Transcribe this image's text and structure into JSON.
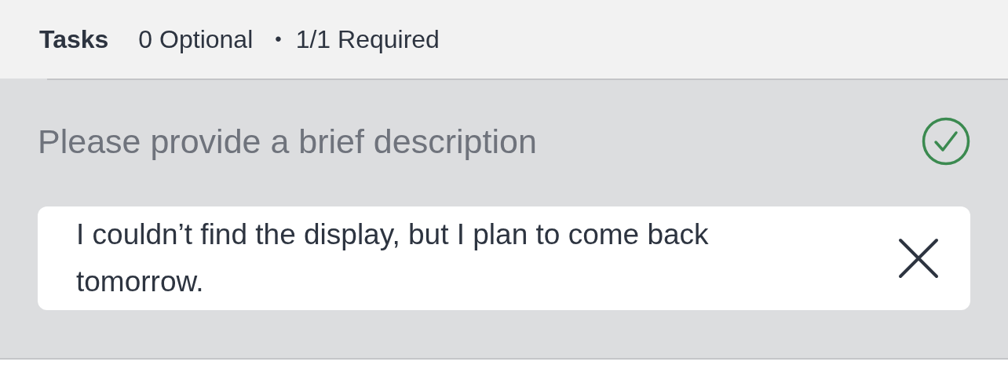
{
  "header": {
    "title": "Tasks",
    "optional": "0 Optional",
    "separator": "•",
    "required": "1/1 Required"
  },
  "task": {
    "prompt": "Please provide a brief description",
    "completed": true,
    "answer": "I couldn’t find the display, but I plan to come back tomorrow."
  }
}
